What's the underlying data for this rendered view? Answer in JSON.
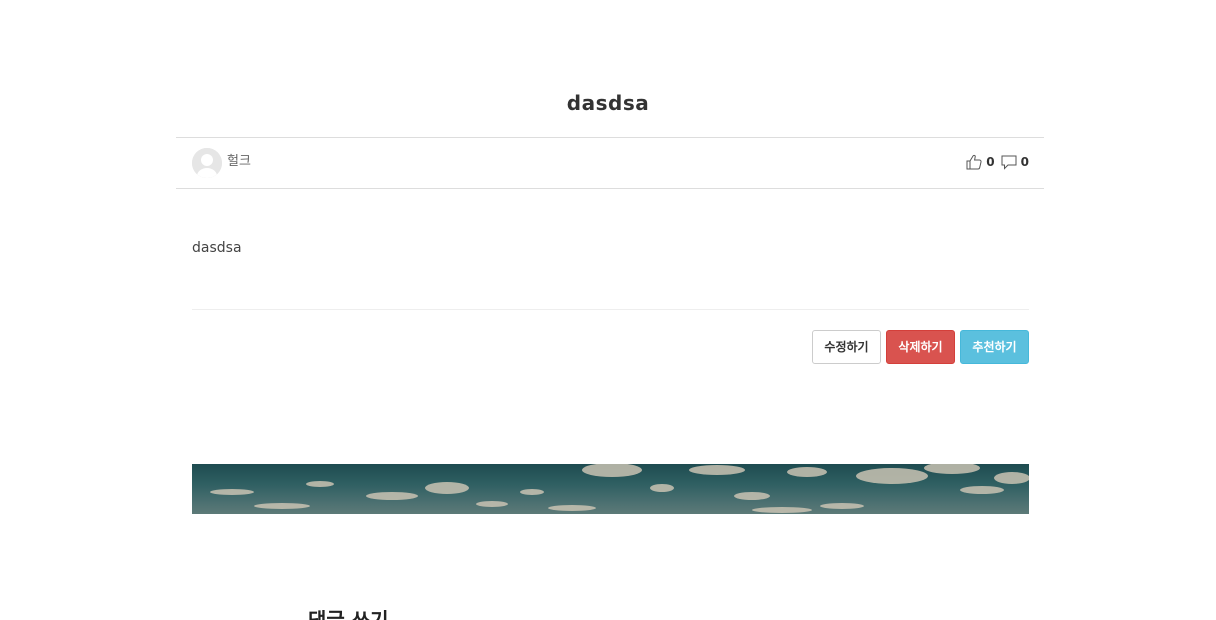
{
  "post": {
    "title": "dasdsa",
    "author": "헐크",
    "likes": "0",
    "comments": "0",
    "body": "dasdsa"
  },
  "actions": {
    "edit_label": "수정하기",
    "delete_label": "삭제하기",
    "recommend_label": "추천하기"
  },
  "section": {
    "heading": "댓글 쓰기"
  },
  "icons": {
    "avatar": "user-avatar-icon",
    "like": "thumbs-up-icon",
    "comment": "comment-icon"
  },
  "colors": {
    "delete": "#d9534f",
    "recommend": "#5bc0de",
    "border": "#dddddd"
  }
}
